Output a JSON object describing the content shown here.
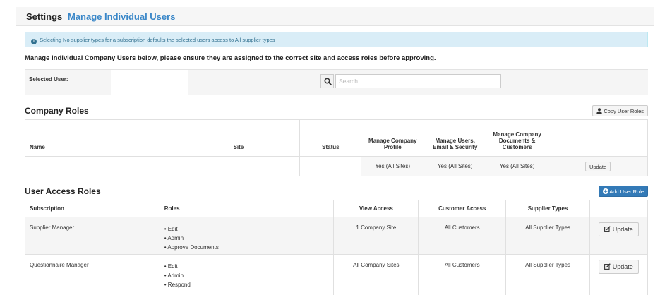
{
  "header": {
    "section": "Settings",
    "page_title": "Manage Individual Users"
  },
  "info_alert": "Selecting No supplier types for a subscription defaults the selected users access to All supplier types",
  "intro_text": "Manage Individual Company Users below, please ensure they are assigned to the correct site and access roles before approving.",
  "selected_user": {
    "label": "Selected User:",
    "value": ""
  },
  "search": {
    "placeholder": "Search..."
  },
  "company_roles": {
    "title": "Company Roles",
    "copy_button": "Copy User Roles",
    "columns": [
      "Name",
      "Site",
      "Status",
      "Manage Company Profile",
      "Manage Users, Email & Security",
      "Manage Company Documents & Customers",
      ""
    ],
    "row": {
      "name": "",
      "site": "",
      "status": "",
      "manage_company_profile": "Yes (All Sites)",
      "manage_users_email_security": "Yes (All Sites)",
      "manage_documents_customers": "Yes (All Sites)",
      "update_label": "Update"
    }
  },
  "user_access_roles": {
    "title": "User Access Roles",
    "add_button": "Add User Role",
    "columns": [
      "Subscription",
      "Roles",
      "View Access",
      "Customer Access",
      "Supplier Types",
      ""
    ],
    "rows": [
      {
        "subscription": "Supplier Manager",
        "roles": [
          "• Edit",
          "• Admin",
          "• Approve Documents"
        ],
        "view_access": "1 Company Site",
        "customer_access": "All Customers",
        "supplier_types": "All Supplier Types",
        "update_label": "Update"
      },
      {
        "subscription": "Questionnaire Manager",
        "roles": [
          "• Edit",
          "• Admin",
          "• Respond"
        ],
        "view_access": "All Company Sites",
        "customer_access": "All Customers",
        "supplier_types": "All Supplier Types",
        "update_label": "Update"
      }
    ]
  },
  "colors": {
    "accent": "#3a87c8",
    "info_bg": "#d9edf7",
    "info_text": "#31708f",
    "primary_button": "#337ab7"
  }
}
